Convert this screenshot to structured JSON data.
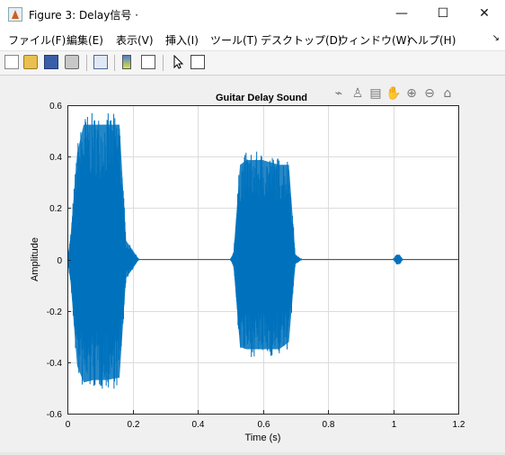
{
  "window": {
    "title": "Figure 3: Delay信号 ·",
    "minimize": "—",
    "maximize": "☐",
    "close": "✕"
  },
  "menu": [
    {
      "label": "ファイル(F)"
    },
    {
      "label": "編集(E)"
    },
    {
      "label": "表示(V)"
    },
    {
      "label": "挿入(I)"
    },
    {
      "label": "ツール(T)"
    },
    {
      "label": "デスクトップ(D)"
    },
    {
      "label": "ウィンドウ(W)"
    },
    {
      "label": "ヘルプ(H)"
    }
  ],
  "menu_overflow_icon": "↘",
  "toolbar_icons": [
    "new-figure-icon",
    "open-file-icon",
    "save-icon",
    "print-icon",
    "link-plot-icon",
    "insert-colorbar-icon",
    "insert-legend-icon",
    "select-arrow-icon",
    "property-inspector-icon"
  ],
  "axes_toolbar_icons": [
    "export-icon",
    "brush-icon",
    "data-tips-icon",
    "pan-icon",
    "zoom-in-icon",
    "zoom-out-icon",
    "home-icon"
  ],
  "colors": {
    "line": "#0072BD",
    "grid": "#dcdcdc",
    "axes_bg": "#ffffff",
    "figure_bg": "#f0f0f0"
  },
  "chart_data": {
    "type": "line",
    "title": "Guitar Delay Sound",
    "xlabel": "Time (s)",
    "ylabel": "Amplitude",
    "xlim": [
      0,
      1.2
    ],
    "ylim": [
      -0.6,
      0.6
    ],
    "xticks": [
      0,
      0.2,
      0.4,
      0.6,
      0.8,
      1,
      1.2
    ],
    "xtick_labels": [
      "0",
      "0.2",
      "0.4",
      "0.6",
      "0.8",
      "1",
      "1.2"
    ],
    "yticks": [
      -0.6,
      -0.4,
      -0.2,
      0,
      0.2,
      0.4,
      0.6
    ],
    "ytick_labels": [
      "-0.6",
      "-0.4",
      "-0.2",
      "0",
      "0.2",
      "0.4",
      "0.6"
    ],
    "grid": true,
    "series": [
      {
        "envelope_time": [
          0,
          0.01,
          0.03,
          0.05,
          0.08,
          0.12,
          0.16,
          0.18,
          0.2,
          0.22,
          0.3,
          0.5,
          0.51,
          0.53,
          0.55,
          0.6,
          0.65,
          0.68,
          0.7,
          0.72,
          0.8,
          1.0,
          1.01,
          1.02,
          1.03,
          1.2
        ],
        "envelope_max": [
          0.0,
          0.1,
          0.45,
          0.57,
          0.57,
          0.57,
          0.57,
          0.08,
          0.04,
          0.0,
          0.0,
          0.0,
          0.03,
          0.4,
          0.42,
          0.42,
          0.4,
          0.4,
          0.02,
          0.0,
          0.0,
          0.0,
          0.02,
          0.02,
          0.0,
          0.0
        ],
        "envelope_min": [
          0.0,
          -0.1,
          -0.45,
          -0.52,
          -0.51,
          -0.51,
          -0.5,
          -0.08,
          -0.04,
          0.0,
          0.0,
          0.0,
          -0.03,
          -0.37,
          -0.38,
          -0.38,
          -0.38,
          -0.35,
          -0.02,
          0.0,
          0.0,
          0.0,
          -0.02,
          -0.02,
          0.0,
          0.0
        ]
      }
    ]
  }
}
